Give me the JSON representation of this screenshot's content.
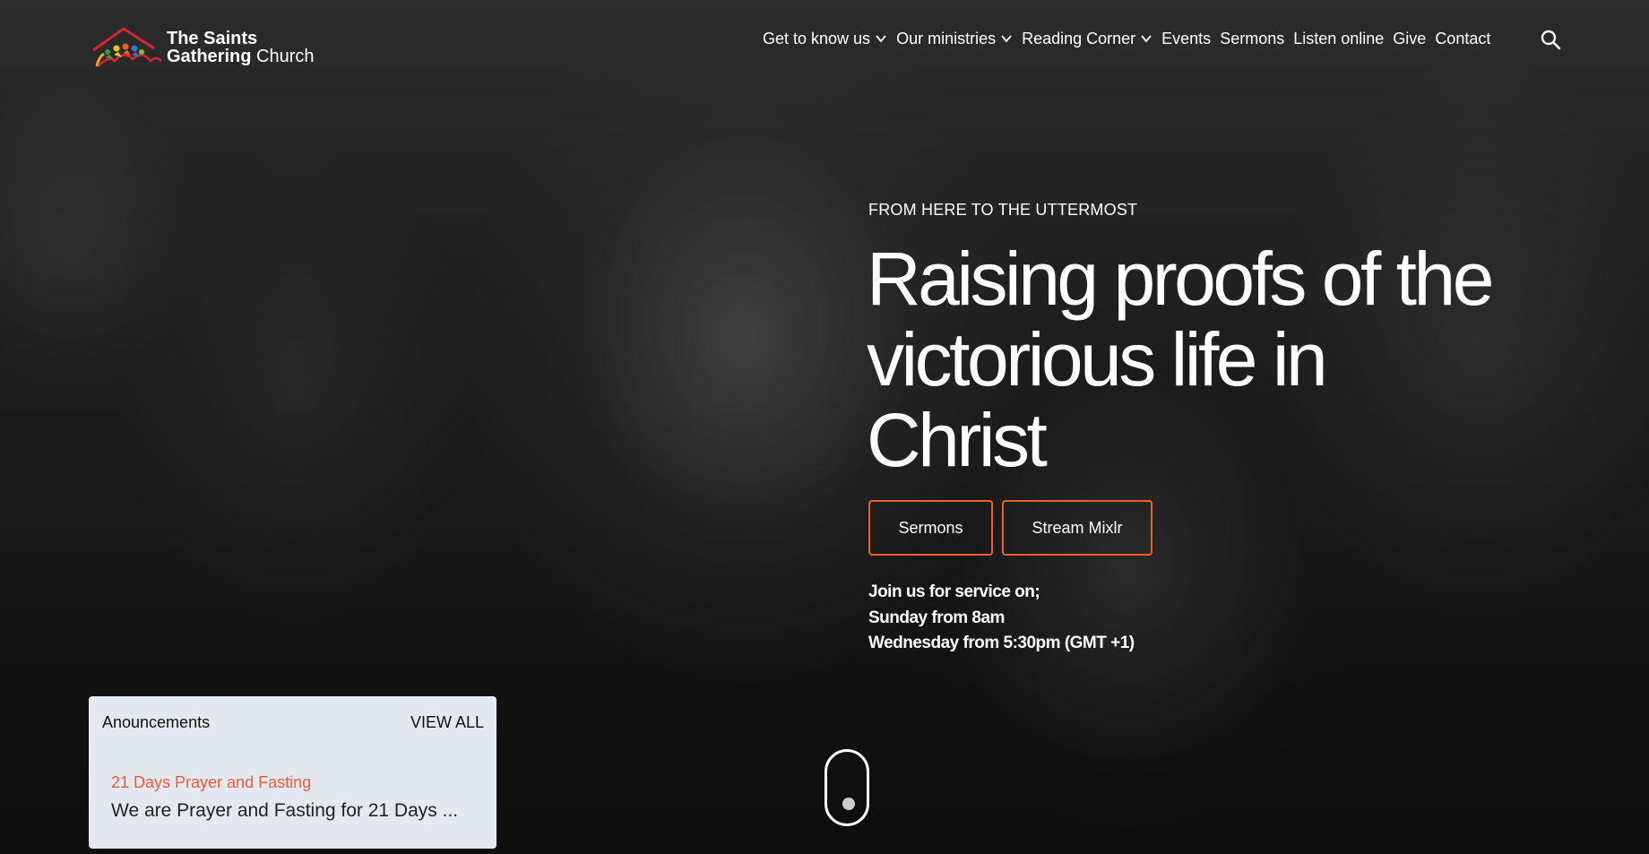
{
  "brand": {
    "name_line1": "The Saints",
    "name_line2_bold": "Gathering",
    "name_line2_light": " Church",
    "logo_icon": "house-people-logo"
  },
  "nav": {
    "items": [
      {
        "label": "Get to know us",
        "has_dropdown": true
      },
      {
        "label": "Our ministries",
        "has_dropdown": true
      },
      {
        "label": "Reading Corner",
        "has_dropdown": true
      },
      {
        "label": "Events",
        "has_dropdown": false
      },
      {
        "label": "Sermons",
        "has_dropdown": false
      },
      {
        "label": "Listen online",
        "has_dropdown": false
      },
      {
        "label": "Give",
        "has_dropdown": false
      },
      {
        "label": "Contact",
        "has_dropdown": false
      }
    ],
    "search_icon": "search-icon"
  },
  "hero": {
    "tagline": "FROM HERE TO THE UTTERMOST",
    "headline": "Raising proofs of the victorious life in Christ",
    "buttons": {
      "sermons": "Sermons",
      "stream": "Stream Mixlr"
    },
    "service": {
      "line1": "Join us for service on;",
      "line2": "Sunday from 8am",
      "line3": "Wednesday from 5:30pm (GMT +1)"
    }
  },
  "announcements": {
    "title": "Anouncements",
    "view_all": "VIEW ALL",
    "item": {
      "title": "21 Days Prayer and Fasting",
      "text": "We are Prayer and Fasting for 21 Days ..."
    }
  },
  "colors": {
    "accent": "#e8622a",
    "announcement_link": "#ef5b3a",
    "card_bg": "#e4e9f1"
  }
}
